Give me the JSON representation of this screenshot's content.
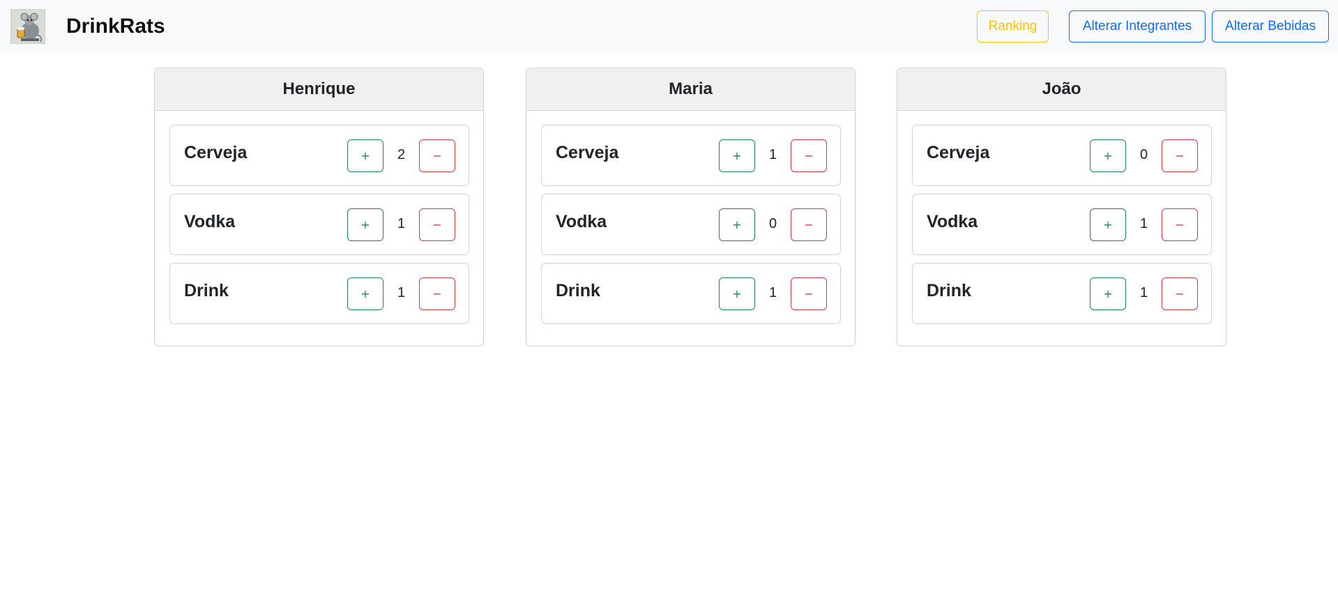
{
  "navbar": {
    "brand": "DrinkRats",
    "logo_icon": "rat-with-beer-logo",
    "buttons": {
      "ranking": "Ranking",
      "alterar_integrantes": "Alterar Integrantes",
      "alterar_bebidas": "Alterar Bebidas"
    }
  },
  "colors": {
    "success": "#198754",
    "danger": "#dc3545",
    "warning": "#ffc107",
    "primary": "#0d6efd"
  },
  "controls": {
    "plus": "+",
    "minus": "−"
  },
  "members": [
    {
      "name": "Henrique",
      "drinks": [
        {
          "name": "Cerveja",
          "count": "2"
        },
        {
          "name": "Vodka",
          "count": "1"
        },
        {
          "name": "Drink",
          "count": "1"
        }
      ]
    },
    {
      "name": "Maria",
      "drinks": [
        {
          "name": "Cerveja",
          "count": "1"
        },
        {
          "name": "Vodka",
          "count": "0"
        },
        {
          "name": "Drink",
          "count": "1"
        }
      ]
    },
    {
      "name": "João",
      "drinks": [
        {
          "name": "Cerveja",
          "count": "0"
        },
        {
          "name": "Vodka",
          "count": "1"
        },
        {
          "name": "Drink",
          "count": "1"
        }
      ]
    }
  ]
}
